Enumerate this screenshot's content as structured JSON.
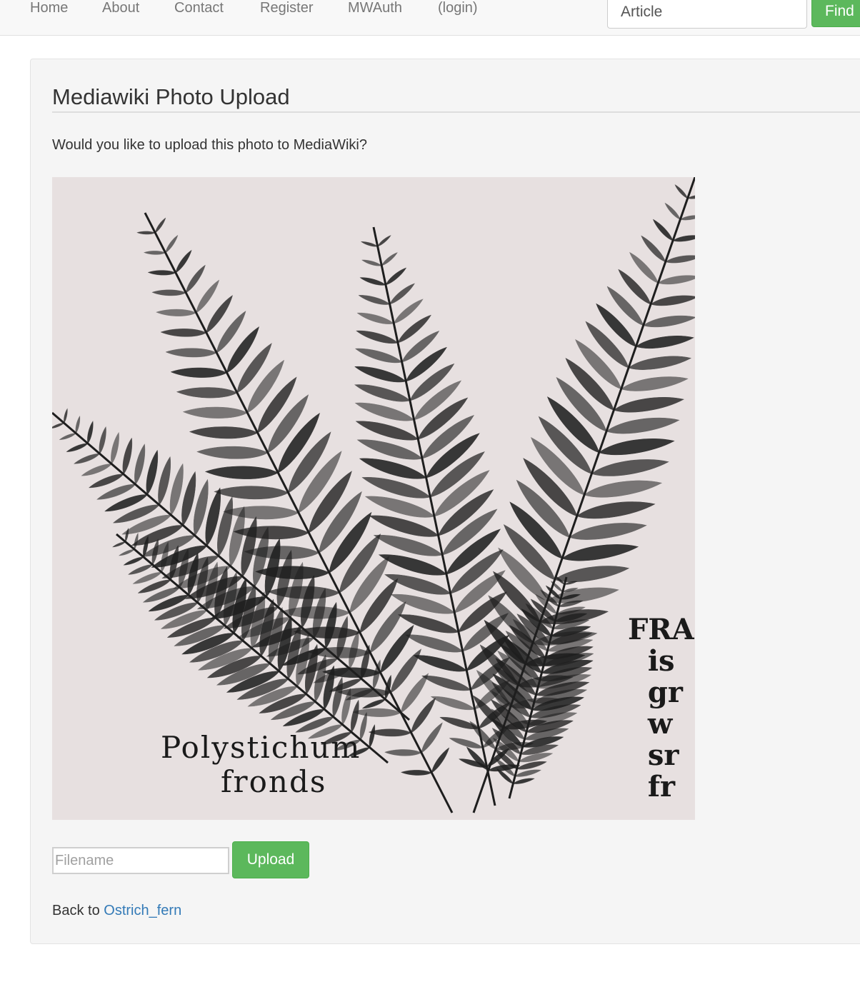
{
  "navbar": {
    "links": [
      {
        "label": "Home"
      },
      {
        "label": "About"
      },
      {
        "label": "Contact"
      },
      {
        "label": "Register"
      },
      {
        "label": "MWAuth"
      },
      {
        "label": "(login)"
      }
    ],
    "search_value": "Article",
    "find_label": "Find"
  },
  "main": {
    "title": "Mediawiki Photo Upload",
    "question": "Would you like to upload this photo to MediaWiki?",
    "photo": {
      "caption_line1": "Polystichum",
      "caption_line2": "fronds",
      "edge_text": "FRA\n  is\n  gr\n  w\n  sr\n  fr"
    },
    "filename_placeholder": "Filename",
    "upload_label": "Upload",
    "back_prefix": "Back to ",
    "back_link": "Ostrich_fern"
  }
}
